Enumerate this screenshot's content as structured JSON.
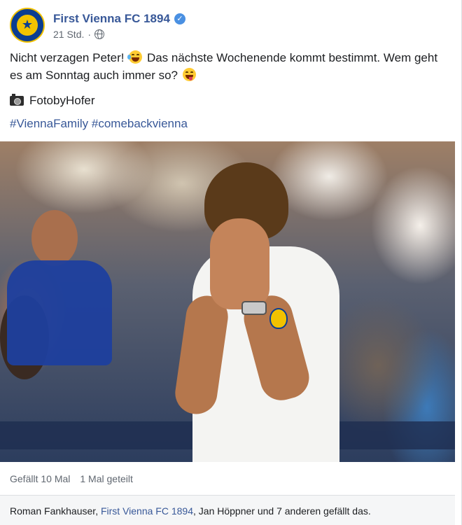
{
  "page": {
    "name": "First Vienna FC 1894",
    "time": "21 Std.",
    "separator": "·"
  },
  "post": {
    "line1": "Nicht verzagen Peter!",
    "line2": "Das nächste Wochenende kommt bestimmt. Wem",
    "line3": "geht es am Sonntag auch immer so?",
    "photo_credit": "FotobyHofer",
    "hashtag1": "#ViennaFamily",
    "hashtag2": "#comebackvienna"
  },
  "stats": {
    "likes": "Gefällt 10 Mal",
    "shares": "1 Mal geteilt"
  },
  "likers": {
    "name1": "Roman Fankhauser",
    "sep1": ", ",
    "name2": "First Vienna FC 1894",
    "sep2": ", ",
    "rest": "Jan Höppner und 7 anderen gefällt das."
  },
  "icons": {
    "verified": "verified-badge-icon",
    "privacy": "globe-icon",
    "camera": "camera-icon",
    "emoji1": "rolling-laughing-emoji",
    "emoji2": "winking-tongue-emoji"
  },
  "colors": {
    "link": "#385898",
    "verified": "#4a90e2",
    "meta": "#606770",
    "club_blue": "#0b3d91",
    "club_yellow": "#f2c200"
  }
}
